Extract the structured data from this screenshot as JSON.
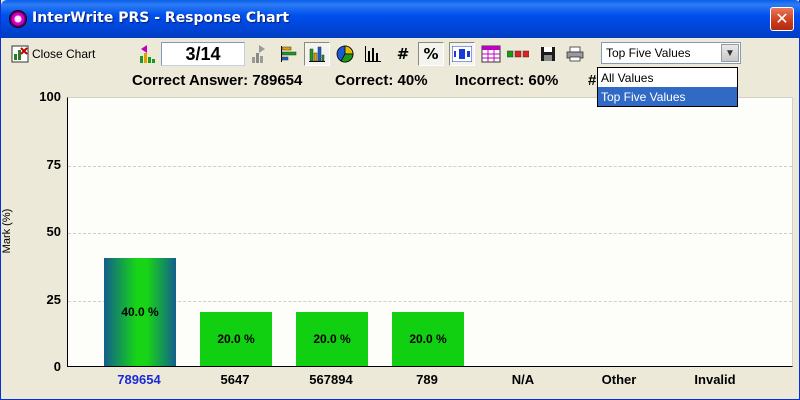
{
  "window": {
    "title": "InterWrite PRS - Response Chart",
    "close_glyph": "✕"
  },
  "toolbar": {
    "close_chart_label": "Close Chart",
    "page_counter": "3/14",
    "number_symbol": "#",
    "percent_symbol": "%",
    "filter_select": {
      "selected": "Top Five Values",
      "options": [
        "All Values",
        "Top Five Values"
      ],
      "open": true
    },
    "icons": [
      "close-chart-icon",
      "previous-question-icon",
      "next-question-icon",
      "horizontal-bar-chart-icon",
      "vertical-bar-chart-icon",
      "pie-chart-icon",
      "column-chart-icon",
      "number-display-icon",
      "percent-display-icon",
      "numbered-list-icon",
      "grid-view-icon",
      "color-blocks-icon",
      "save-icon",
      "print-icon"
    ]
  },
  "summary": {
    "correct_answer": "Correct Answer: 789654",
    "correct": "Correct: 40%",
    "incorrect": "Incorrect: 60%",
    "extra": "#"
  },
  "colors": {
    "correct_bar_start": "#135f8c",
    "correct_bar_mid": "#17d417",
    "answer_bar": "#11d011",
    "correct_label": "#1b2ad6",
    "title_bar": "#0050ee"
  },
  "chart_data": {
    "type": "bar",
    "ylabel": "Mark (%)",
    "ylim": [
      0,
      100
    ],
    "yticks": [
      0,
      25,
      50,
      75,
      100
    ],
    "grid": true,
    "categories": [
      "789654",
      "5647",
      "567894",
      "789",
      "N/A",
      "Other",
      "Invalid"
    ],
    "values": [
      40,
      20,
      20,
      20,
      0,
      0,
      0
    ],
    "data_labels": [
      "40.0 %",
      "20.0 %",
      "20.0 %",
      "20.0 %",
      "",
      "",
      ""
    ],
    "correct_category": "789654"
  }
}
